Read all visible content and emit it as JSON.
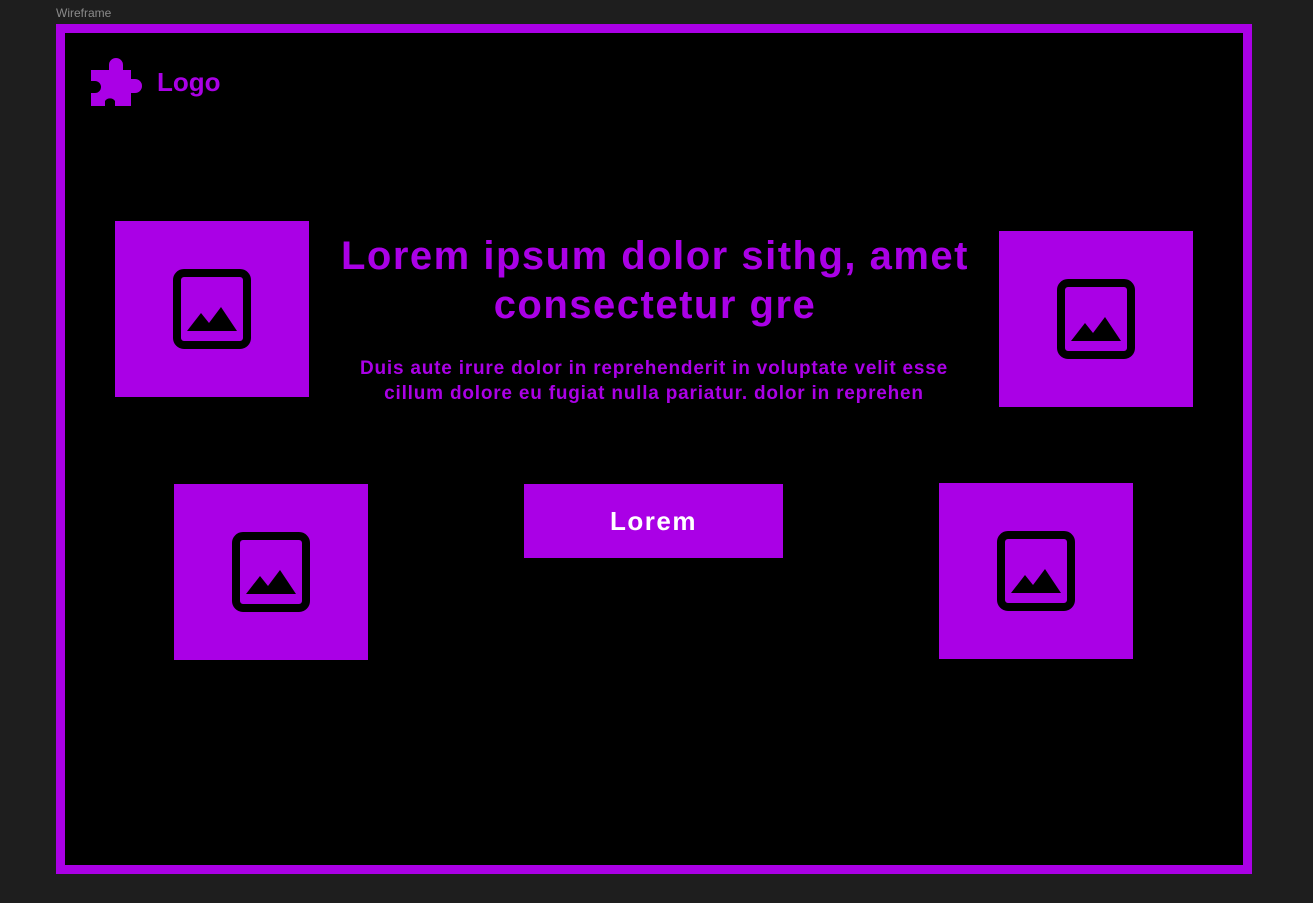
{
  "canvas": {
    "frame_label": "Wireframe"
  },
  "header": {
    "logo_text": "Logo",
    "logo_icon": "puzzle-piece-icon"
  },
  "hero": {
    "title": "Lorem ipsum dolor sithg, amet consectetur  gre",
    "subtitle": "Duis aute irure dolor in reprehenderit in voluptate velit esse cillum dolore eu fugiat nulla pariatur.  dolor in reprehen",
    "cta_label": "Lorem"
  },
  "image_tiles": [
    {
      "icon": "image-placeholder-icon"
    },
    {
      "icon": "image-placeholder-icon"
    },
    {
      "icon": "image-placeholder-icon"
    },
    {
      "icon": "image-placeholder-icon"
    }
  ],
  "colors": {
    "accent": "#aa00e6",
    "frame_background": "#000000",
    "canvas_background": "#1e1e1e",
    "button_text": "#ffffff"
  }
}
